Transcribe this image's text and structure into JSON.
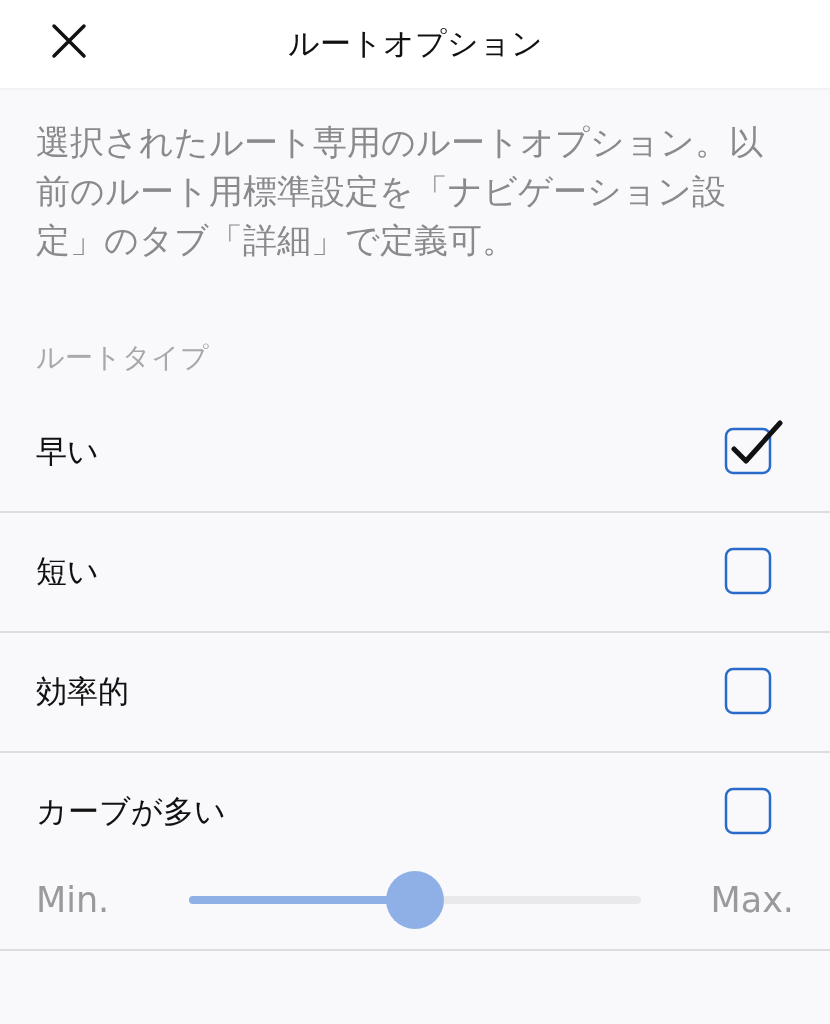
{
  "header": {
    "title": "ルートオプション"
  },
  "description": "選択されたルート専用のルートオプション。以前のルート用標準設定を「ナビゲーション設定」のタブ「詳細」で定義可。",
  "section_label": "ルートタイプ",
  "route_types": [
    {
      "label": "早い",
      "checked": true
    },
    {
      "label": "短い",
      "checked": false
    },
    {
      "label": "効率的",
      "checked": false
    },
    {
      "label": "カーブが多い",
      "checked": false
    }
  ],
  "curviness_slider": {
    "min_label": "Min.",
    "max_label": "Max.",
    "level": 0.5
  }
}
